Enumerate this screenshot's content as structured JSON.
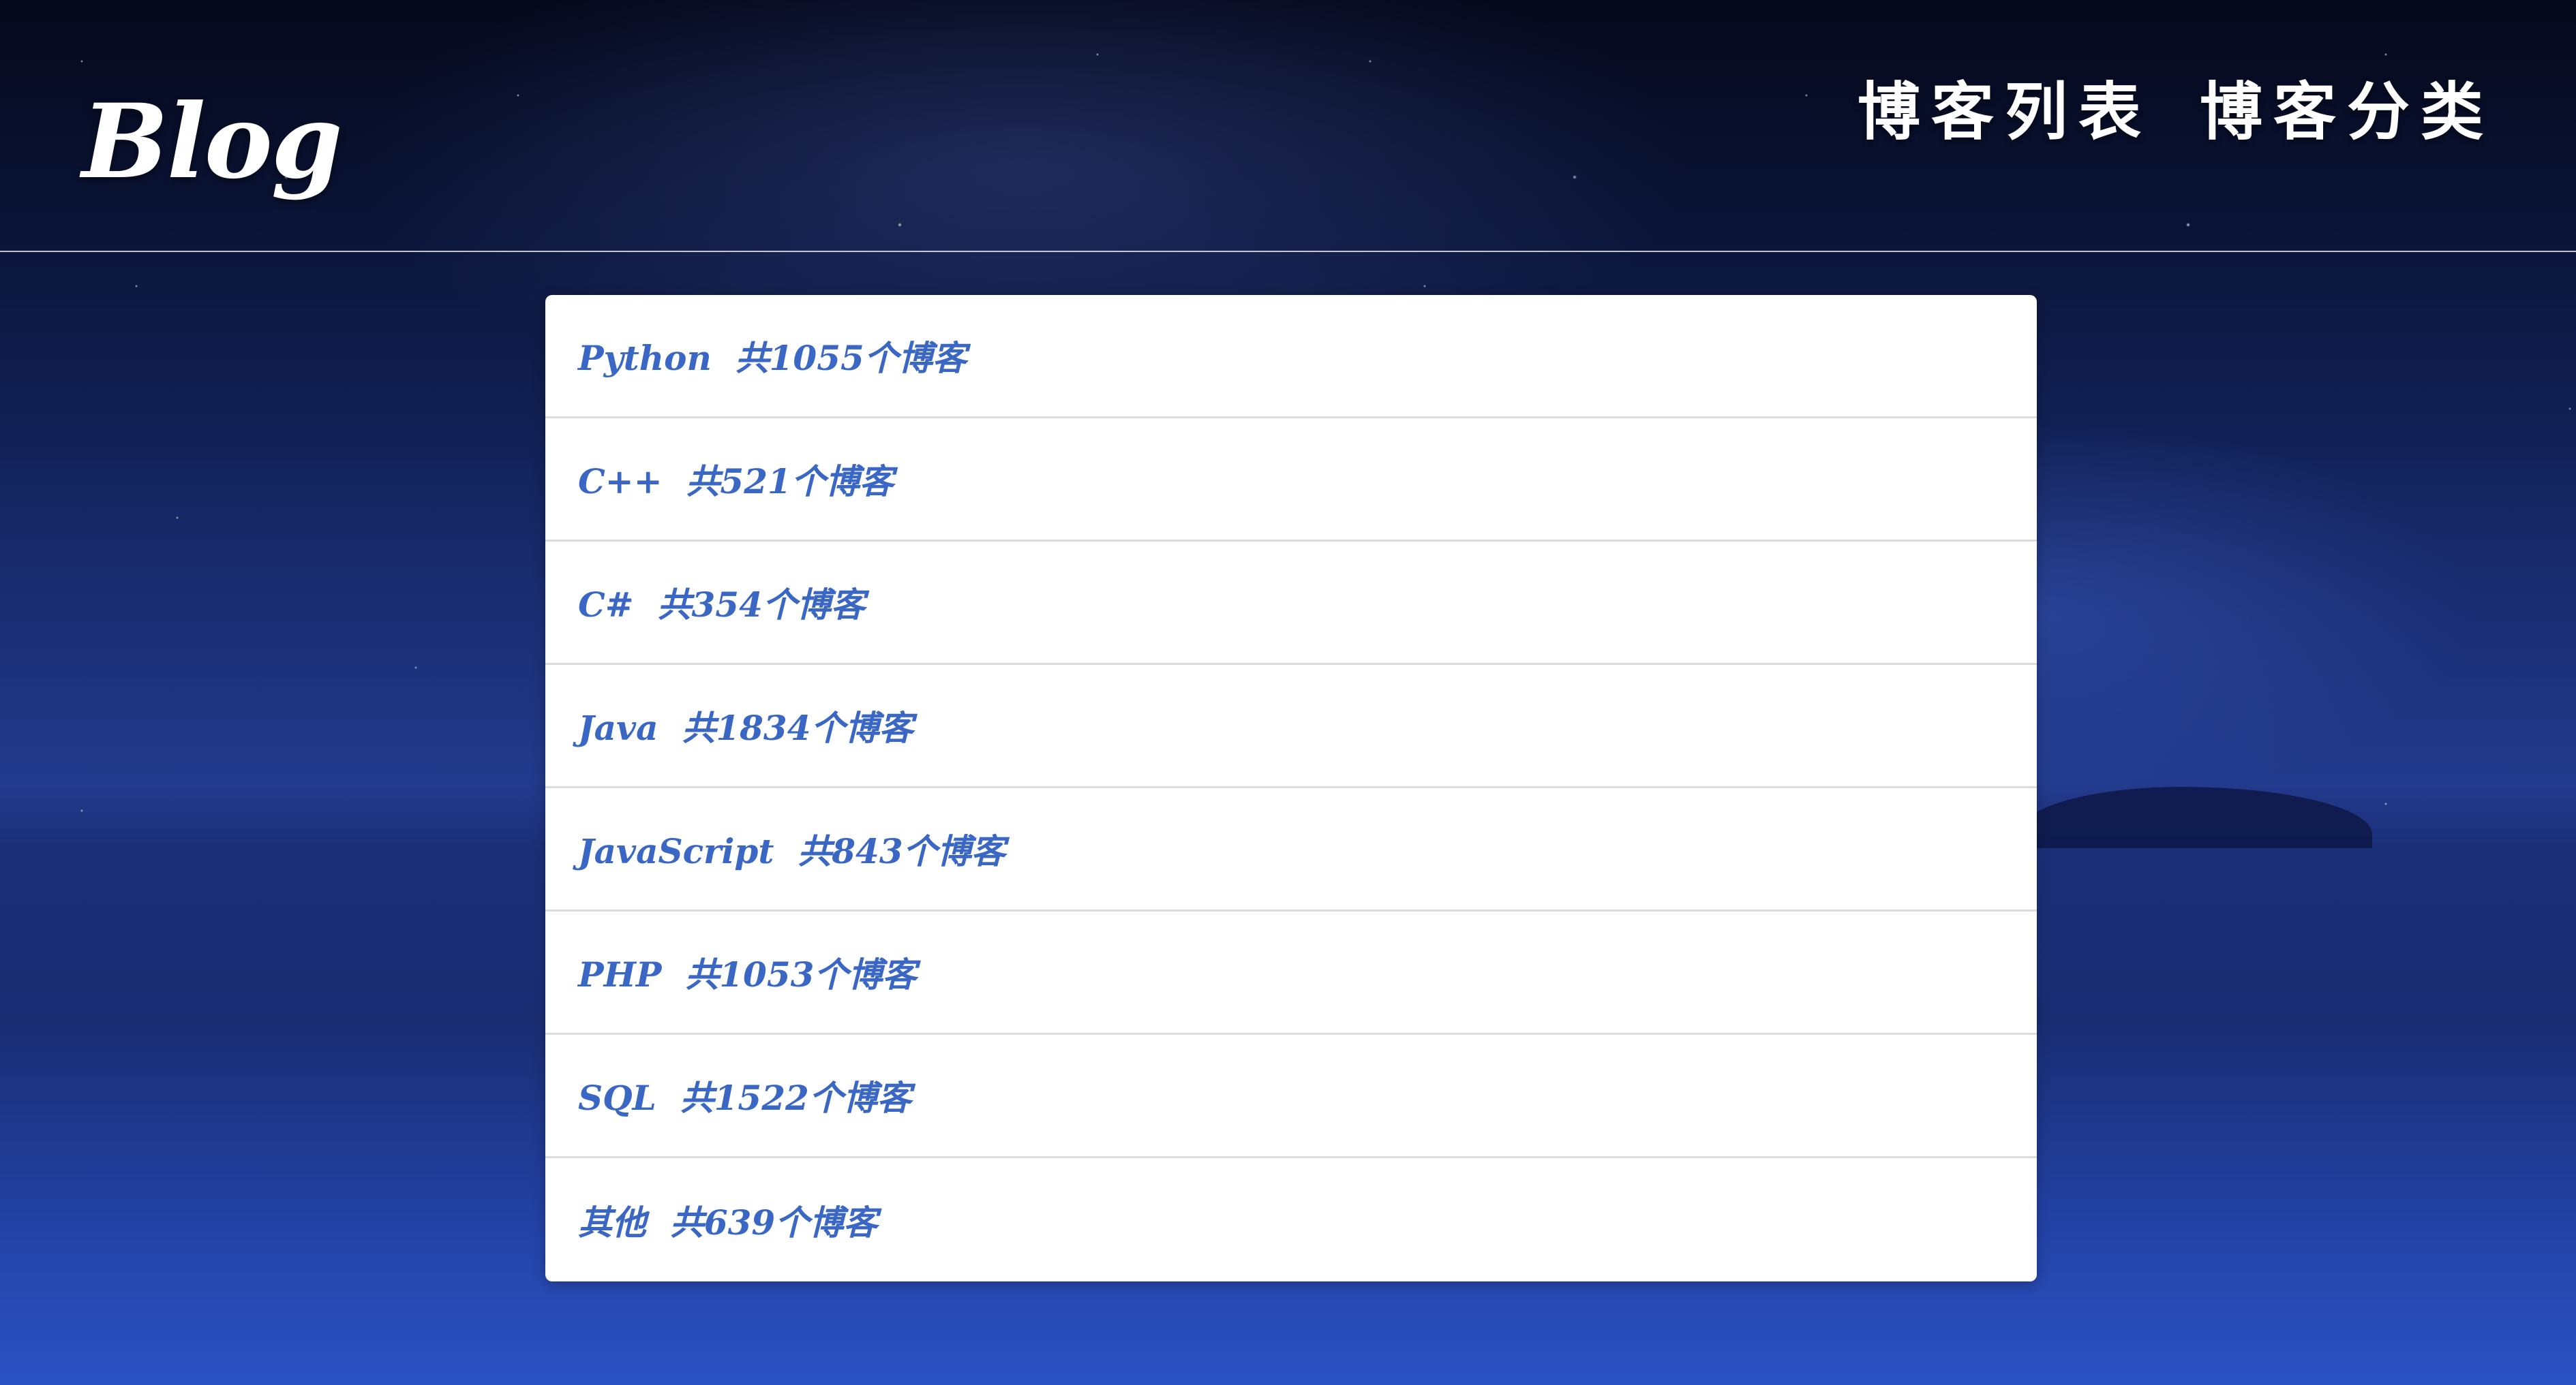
{
  "header": {
    "logo": "Blog",
    "nav": [
      {
        "label": "博客列表"
      },
      {
        "label": "博客分类"
      }
    ]
  },
  "categories": [
    {
      "text": "Python  共1055个博客"
    },
    {
      "text": "C++  共521个博客"
    },
    {
      "text": "C#  共354个博客"
    },
    {
      "text": "Java  共1834个博客"
    },
    {
      "text": "JavaScript  共843个博客"
    },
    {
      "text": "PHP  共1053个博客"
    },
    {
      "text": "SQL  共1522个博客"
    },
    {
      "text": "其他  共639个博客"
    }
  ],
  "colors": {
    "link_text": "#3a67c4",
    "card_bg": "#ffffff",
    "header_text": "#ffffff"
  }
}
